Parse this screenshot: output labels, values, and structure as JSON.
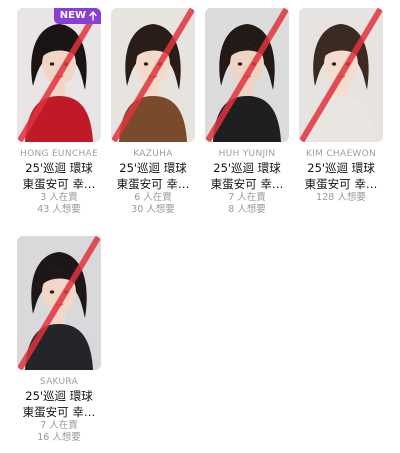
{
  "cards": [
    {
      "name": "HONG EUNCHAE",
      "title_line1": "25'巡迴 環球",
      "title_line2": "東蛋安可 幸…",
      "stat1": "3 人在賣",
      "stat2": "43 人想要",
      "badge": "NEW",
      "bg": "#e9e4e6",
      "hair": "#1b1414",
      "skin": "#f1d6c8",
      "top": "#c01a28"
    },
    {
      "name": "KAZUHA",
      "title_line1": "25'巡迴 環球",
      "title_line2": "東蛋安可 幸…",
      "stat1": "6 人在賣",
      "stat2": "30 人想要",
      "badge": "",
      "bg": "#e7e4e0",
      "hair": "#2a1d17",
      "skin": "#f3dacb",
      "top": "#7a4a2c"
    },
    {
      "name": "HUH YUNJIN",
      "title_line1": "25'巡迴 環球",
      "title_line2": "東蛋安可 幸…",
      "stat1": "7 人在賣",
      "stat2": "8 人想要",
      "badge": "",
      "bg": "#dcdcdc",
      "hair": "#231a17",
      "skin": "#efd3c3",
      "top": "#1f1f22"
    },
    {
      "name": "KIM CHAEWON",
      "title_line1": "25'巡迴 環球",
      "title_line2": "東蛋安可 幸…",
      "stat1": "128 人想要",
      "stat2": "",
      "badge": "",
      "bg": "#e6e3e1",
      "hair": "#3a2a22",
      "skin": "#f4dccf",
      "top": "#e9e6e2"
    },
    {
      "name": "SAKURA",
      "title_line1": "25'巡迴 環球",
      "title_line2": "東蛋安可 幸…",
      "stat1": "7 人在賣",
      "stat2": "16 人想要",
      "badge": "",
      "bg": "#d9d9db",
      "hair": "#1d1717",
      "skin": "#f2d6c7",
      "top": "#23252b"
    }
  ]
}
